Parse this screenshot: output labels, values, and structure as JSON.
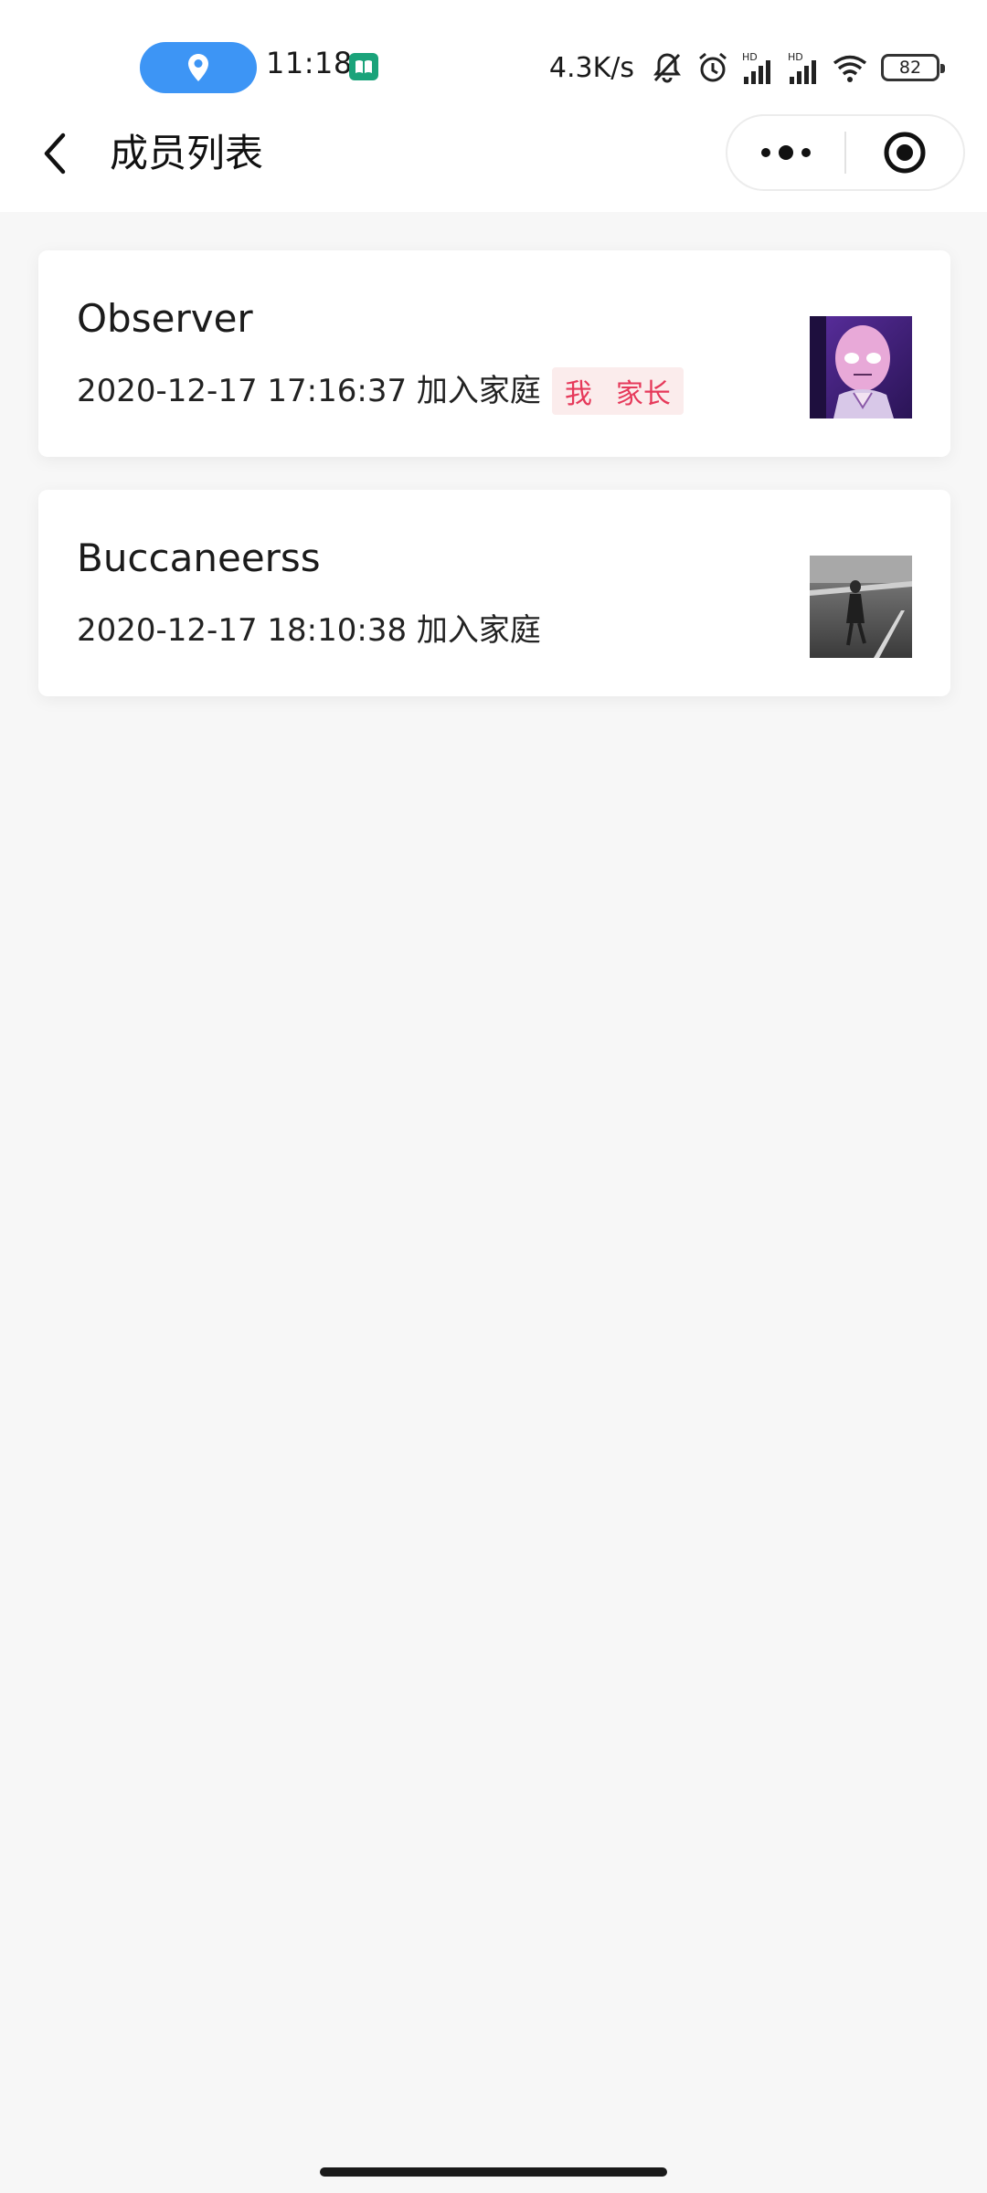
{
  "status_bar": {
    "time": "11:18",
    "net_speed": "4.3K/s",
    "battery": "82",
    "icons": [
      "location-icon",
      "book-icon",
      "mute-icon",
      "alarm-icon",
      "signal-hd-icon",
      "signal-hd-icon",
      "wifi-icon",
      "battery-icon"
    ],
    "location_pill_color": "#3d95f5"
  },
  "nav": {
    "title": "成员列表",
    "back_icon": "chevron-left-icon",
    "more_icon": "more-dots-icon",
    "close_icon": "target-icon"
  },
  "members": [
    {
      "name": "Observer",
      "joined": "2020-12-17 17:16:37 加入家庭",
      "tags": [
        "我",
        "家长"
      ],
      "avatar": "avatar-bald-hero"
    },
    {
      "name": "Buccaneerss",
      "joined": "2020-12-17 18:10:38 加入家庭",
      "tags": [],
      "avatar": "avatar-grayscale-photo"
    }
  ],
  "colors": {
    "tag_text": "#e6395a",
    "tag_bg": "#fbecec",
    "page_bg": "#f7f7f7"
  }
}
